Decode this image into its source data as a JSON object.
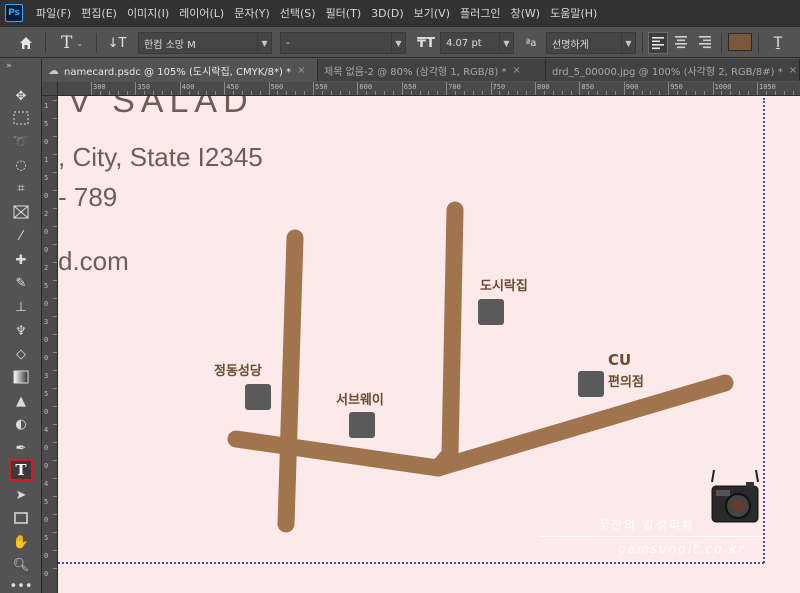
{
  "app": {
    "logo": "Ps",
    "menu": [
      "파일(F)",
      "편집(E)",
      "이미지(I)",
      "레이어(L)",
      "문자(Y)",
      "선택(S)",
      "필터(T)",
      "3D(D)",
      "보기(V)",
      "플러그인",
      "창(W)",
      "도움말(H)"
    ]
  },
  "options": {
    "font_family": "한컴 소망 M",
    "font_style": "-",
    "font_size": "4.07 pt",
    "aa_label": "ªa",
    "antialias": "선명하게",
    "text_color": "#7a5a3a"
  },
  "tabs": [
    {
      "label": "namecard.psdc @ 105% (도시락집, CMYK/8*) *",
      "close": "×"
    },
    {
      "label": "제목 없음-2 @ 80% (삼각형 1, RGB/8) *",
      "close": "×"
    },
    {
      "label": "drd_5_00000.jpg @ 100% (사각형 2, RGB/8#) *",
      "close": "×"
    }
  ],
  "ruler": {
    "top_labels": [
      "300",
      "350",
      "400",
      "450",
      "500",
      "550",
      "600",
      "650",
      "700",
      "750",
      "800",
      "850",
      "900",
      "950",
      "1000",
      "1050",
      "1100"
    ],
    "left_labels": [
      "1",
      "5",
      "0",
      "1",
      "5",
      "0",
      "2",
      "0",
      "0",
      "2",
      "5",
      "0",
      "3",
      "0",
      "0",
      "3",
      "5",
      "0",
      "4",
      "0",
      "0",
      "4",
      "5",
      "0",
      "5",
      "0",
      "0"
    ]
  },
  "document": {
    "line1": "V SALAD",
    "line2": ", City, State I2345",
    "line3": "- 789",
    "line4": "d.com"
  },
  "map": {
    "road_color": "#a0754d",
    "marker_color": "#5a5a5a",
    "places": {
      "dosirak": "도시락집",
      "cathedral": "정동성당",
      "subway": "서브웨이",
      "cu_top": "CU",
      "cu_bottom": "편의점"
    }
  },
  "watermark": {
    "title": "꽃잔의 감성리뷰",
    "url": "gamsungit.co.kr"
  }
}
